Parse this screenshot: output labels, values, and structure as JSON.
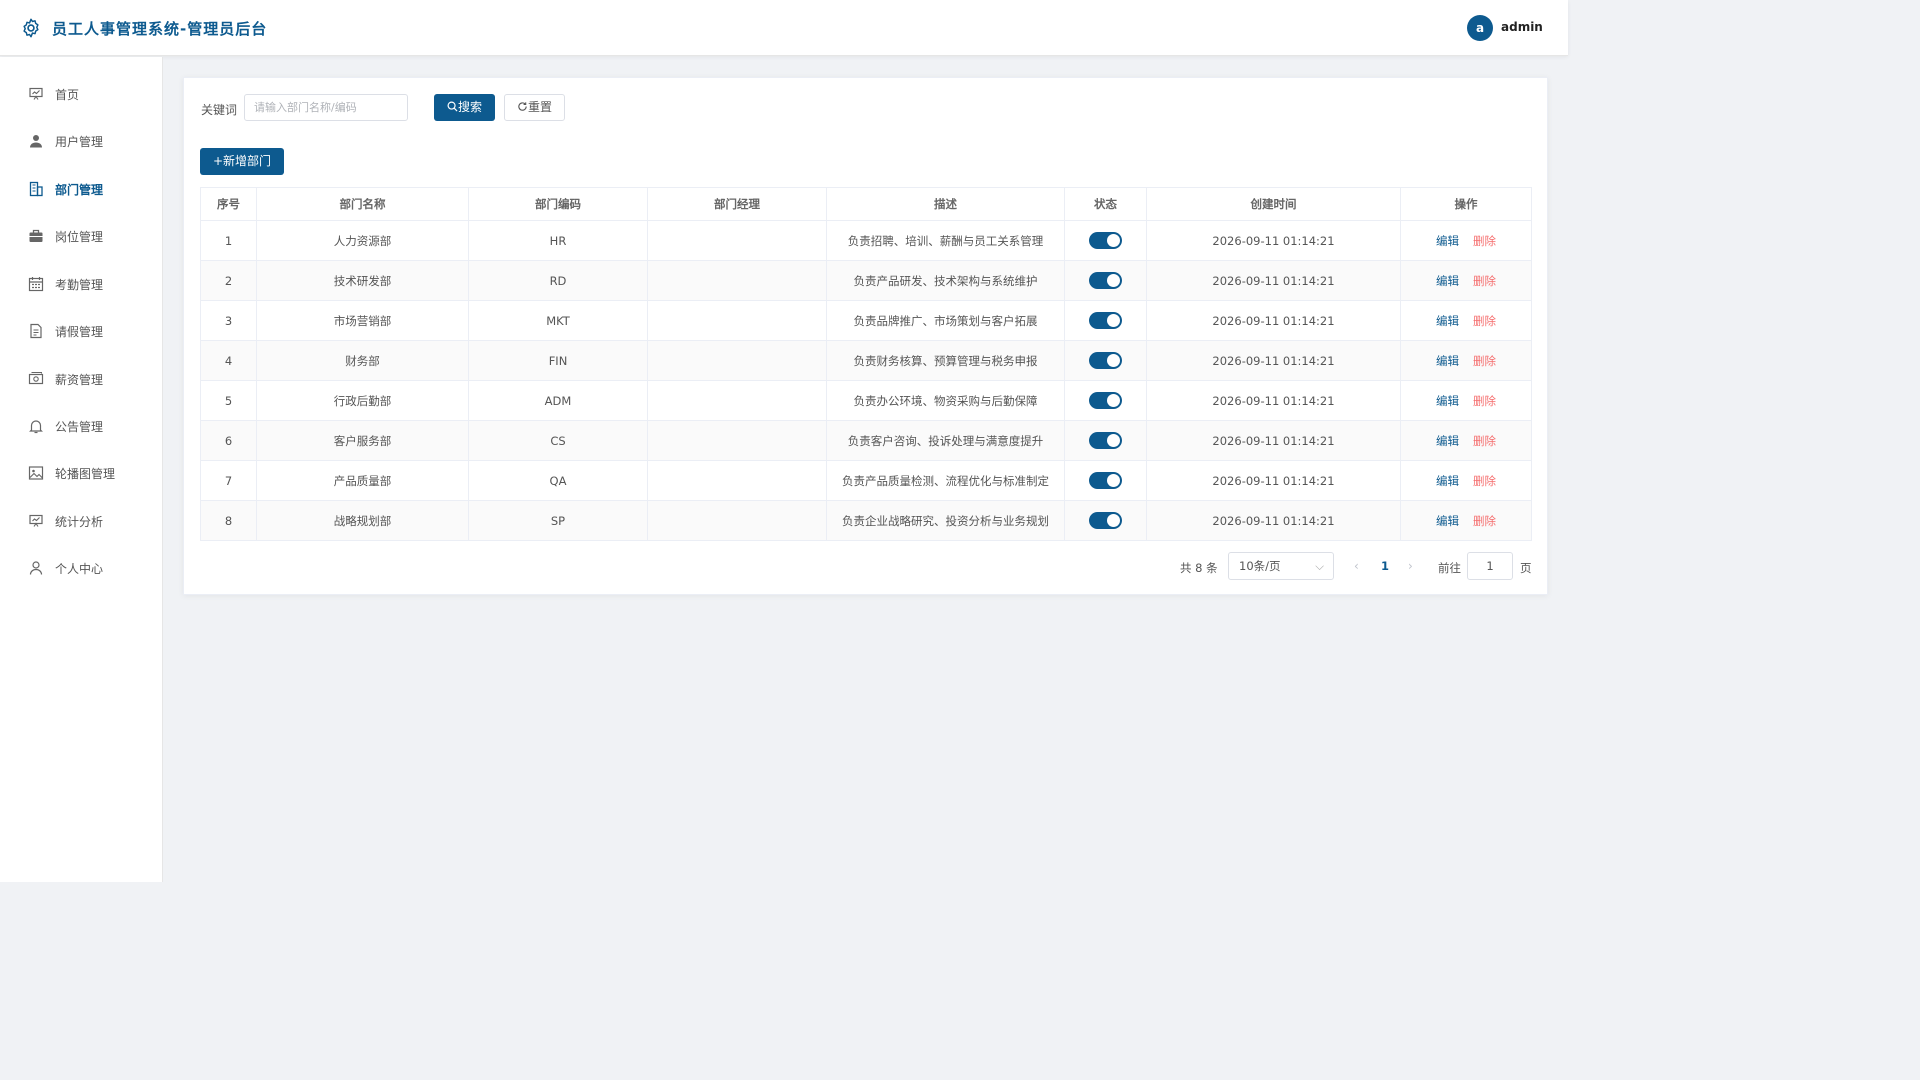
{
  "header": {
    "title": "员工人事管理系统-管理员后台",
    "avatar_letter": "a",
    "username": "admin",
    "brand_color": "#0d5a8f"
  },
  "sidebar": {
    "items": [
      {
        "label": "首页",
        "icon": "home-chart-icon",
        "active": false
      },
      {
        "label": "用户管理",
        "icon": "user-icon",
        "active": false
      },
      {
        "label": "部门管理",
        "icon": "building-icon",
        "active": true
      },
      {
        "label": "岗位管理",
        "icon": "briefcase-icon",
        "active": false
      },
      {
        "label": "考勤管理",
        "icon": "calendar-icon",
        "active": false
      },
      {
        "label": "请假管理",
        "icon": "document-icon",
        "active": false
      },
      {
        "label": "薪资管理",
        "icon": "money-icon",
        "active": false
      },
      {
        "label": "公告管理",
        "icon": "bell-icon",
        "active": false
      },
      {
        "label": "轮播图管理",
        "icon": "picture-icon",
        "active": false
      },
      {
        "label": "统计分析",
        "icon": "presentation-icon",
        "active": false
      },
      {
        "label": "个人中心",
        "icon": "person-icon",
        "active": false
      }
    ]
  },
  "search": {
    "label": "关键词",
    "placeholder": "请输入部门名称/编码",
    "value": "",
    "search_button": "搜索",
    "reset_button": "重置"
  },
  "toolbar": {
    "add_button": "新增部门"
  },
  "table": {
    "columns": [
      "序号",
      "部门名称",
      "部门编码",
      "部门经理",
      "描述",
      "状态",
      "创建时间",
      "操作"
    ],
    "rows": [
      {
        "no": "1",
        "name": "人力资源部",
        "code": "HR",
        "manager": "",
        "desc": "负责招聘、培训、薪酬与员工关系管理",
        "enabled": true,
        "created": "2026-09-11 01:14:21"
      },
      {
        "no": "2",
        "name": "技术研发部",
        "code": "RD",
        "manager": "",
        "desc": "负责产品研发、技术架构与系统维护",
        "enabled": true,
        "created": "2026-09-11 01:14:21"
      },
      {
        "no": "3",
        "name": "市场营销部",
        "code": "MKT",
        "manager": "",
        "desc": "负责品牌推广、市场策划与客户拓展",
        "enabled": true,
        "created": "2026-09-11 01:14:21"
      },
      {
        "no": "4",
        "name": "财务部",
        "code": "FIN",
        "manager": "",
        "desc": "负责财务核算、预算管理与税务申报",
        "enabled": true,
        "created": "2026-09-11 01:14:21"
      },
      {
        "no": "5",
        "name": "行政后勤部",
        "code": "ADM",
        "manager": "",
        "desc": "负责办公环境、物资采购与后勤保障",
        "enabled": true,
        "created": "2026-09-11 01:14:21"
      },
      {
        "no": "6",
        "name": "客户服务部",
        "code": "CS",
        "manager": "",
        "desc": "负责客户咨询、投诉处理与满意度提升",
        "enabled": true,
        "created": "2026-09-11 01:14:21"
      },
      {
        "no": "7",
        "name": "产品质量部",
        "code": "QA",
        "manager": "",
        "desc": "负责产品质量检测、流程优化与标准制定",
        "enabled": true,
        "created": "2026-09-11 01:14:21"
      },
      {
        "no": "8",
        "name": "战略规划部",
        "code": "SP",
        "manager": "",
        "desc": "负责企业战略研究、投资分析与业务规划",
        "enabled": true,
        "created": "2026-09-11 01:14:21"
      }
    ],
    "edit_label": "编辑",
    "delete_label": "删除"
  },
  "pagination": {
    "total": "共 8 条",
    "page_size": "10条/页",
    "current_page": "1",
    "goto_label": "前往",
    "goto_value": "1",
    "page_suffix": "页"
  }
}
